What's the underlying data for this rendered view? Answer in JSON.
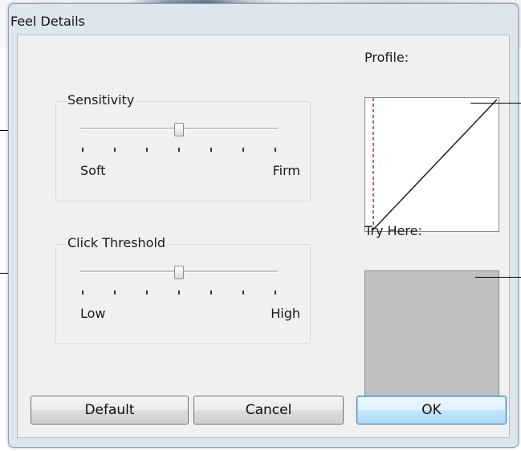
{
  "window": {
    "title": "Feel Details"
  },
  "sensitivity": {
    "label": "Sensitivity",
    "min_label": "Soft",
    "max_label": "Firm",
    "tick_count": 7,
    "value_tick": 4
  },
  "click_threshold": {
    "label": "Click Threshold",
    "min_label": "Low",
    "max_label": "High",
    "tick_count": 7,
    "value_tick": 4
  },
  "profile": {
    "label": "Profile:"
  },
  "try_here": {
    "label": "Try Here:"
  },
  "buttons": {
    "default_label": "Default",
    "cancel_label": "Cancel",
    "ok_label": "OK"
  },
  "colors": {
    "profile_marker": "#cc2222",
    "profile_curve": "#222222",
    "try_area": "#c0c0c0",
    "ok_accent": "#3c7fb1"
  }
}
